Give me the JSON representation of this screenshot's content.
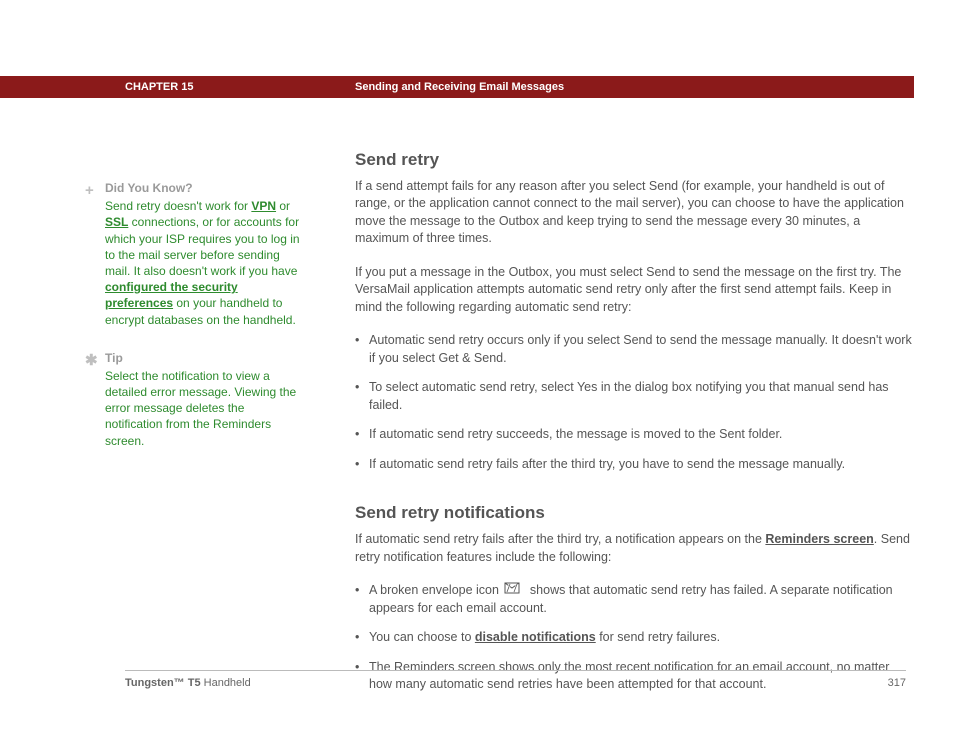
{
  "header": {
    "chapter": "CHAPTER 15",
    "title": "Sending and Receiving Email Messages"
  },
  "sidebar": {
    "didYouKnow": {
      "heading": "Did You Know?",
      "pre": "Send retry doesn't work for ",
      "link1": "VPN",
      "mid1": " or ",
      "link2": "SSL",
      "mid2": " connections, or for accounts for which your ISP requires you to log in to the mail server before sending mail. It also doesn't work if you have ",
      "link3": "configured the security preferences",
      "post": " on your handheld to encrypt databases on the handheld."
    },
    "tip": {
      "heading": "Tip",
      "body": "Select the notification to view a detailed error message. Viewing the error message deletes the notification from the Reminders screen."
    }
  },
  "main": {
    "section1_title": "Send retry",
    "p1": "If a send attempt fails for any reason after you select Send (for example, your handheld is out of range, or the application cannot connect to the mail server), you can choose to have the application move the message to the Outbox and keep trying to send the message every 30 minutes, a maximum of three times.",
    "p2": "If you put a message in the Outbox, you must select Send to send the message on the first try. The VersaMail application attempts automatic send retry only after the first send attempt fails. Keep in mind the following regarding automatic send retry:",
    "bullets1": [
      "Automatic send retry occurs only if you select Send to send the message manually. It doesn't work if you select Get & Send.",
      "To select automatic send retry, select Yes in the dialog box notifying you that manual send has failed.",
      "If automatic send retry succeeds, the message is moved to the Sent folder.",
      "If automatic send retry fails after the third try, you have to send the message manually."
    ],
    "section2_title": "Send retry notifications",
    "p3_pre": "If automatic send retry fails after the third try, a notification appears on the ",
    "p3_link": "Reminders screen",
    "p3_post": ". Send retry notification features include the following:",
    "b2_1_pre": "A broken envelope icon ",
    "b2_1_post": " shows that automatic send retry has failed. A separate notification appears for each email account.",
    "b2_2_pre": "You can choose to ",
    "b2_2_link": "disable notifications",
    "b2_2_post": " for send retry failures.",
    "b2_3": "The Reminders screen shows only the most recent notification for an email account, no matter how many automatic send retries have been attempted for that account."
  },
  "footer": {
    "product_bold": "Tungsten™ T5",
    "product_rest": " Handheld",
    "page": "317"
  }
}
